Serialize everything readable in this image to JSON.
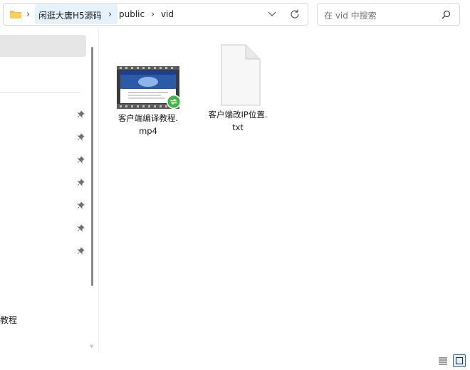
{
  "address_bar": {
    "crumbs": [
      "闲逛大唐H5源码",
      "public",
      "vid"
    ]
  },
  "search": {
    "placeholder": "在 vid 中搜索"
  },
  "nav": {
    "pinned_count": 7,
    "clipped_item": "教程"
  },
  "files": [
    {
      "name_line1": "客户端编译教程.",
      "name_line2": "mp4",
      "icon": "video-thumbnail-icon",
      "badge": "sync-badge-icon"
    },
    {
      "name_line1": "客户端改IP位置.",
      "name_line2": "txt",
      "icon": "text-document-icon"
    }
  ],
  "colors": {
    "accent": "#2b68b4",
    "nav_selected": "#e6e6e6",
    "crumb_highlight": "#e5f1fb",
    "badge_green": "#3fb63f"
  }
}
